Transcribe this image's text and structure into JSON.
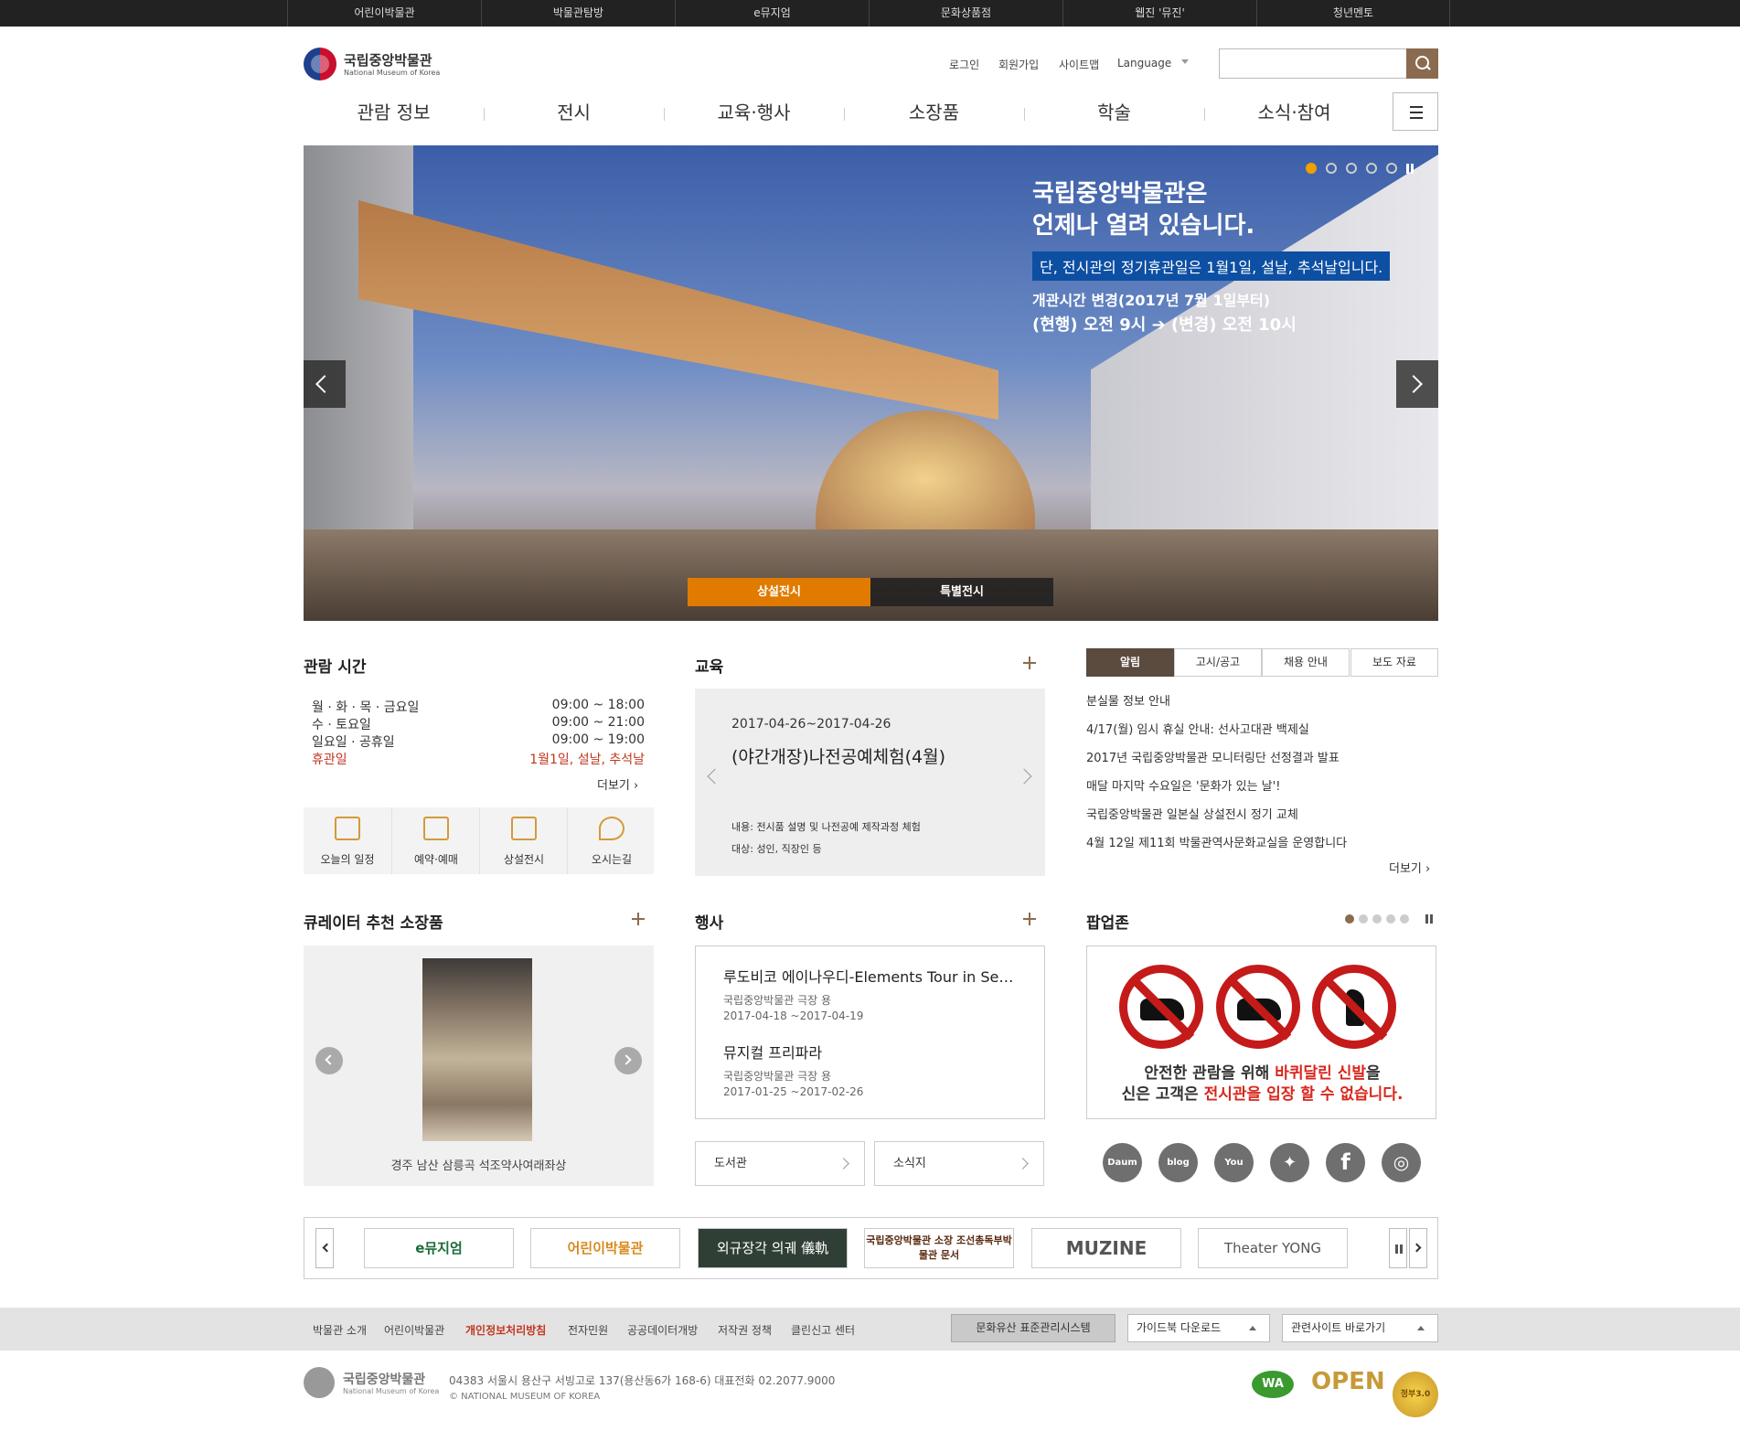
{
  "topbar": [
    "어린이박물관",
    "박물관탐방",
    "e뮤지엄",
    "문화상품점",
    "웹진 '뮤진'",
    "청년멘토"
  ],
  "header": {
    "logo_kr": "국립중앙박물관",
    "logo_en": "National Museum of Korea",
    "util": [
      "로그인",
      "회원가입",
      "사이트맵",
      "Language"
    ]
  },
  "gnb": [
    "관람 정보",
    "전시",
    "교육·행사",
    "소장품",
    "학술",
    "소식·참여"
  ],
  "hero": {
    "line1": "국립중앙박물관은",
    "line2": "언제나 열려 있습니다.",
    "note": "단, 전시관의 정기휴관일은 1월1일, 설날, 추석날입니다.",
    "change": "개관시간 변경(2017년 7월 1일부터)",
    "change2": "(현행) 오전 9시 ➔ (변경) 오전 10시",
    "tabs": [
      "상설전시",
      "특별전시"
    ],
    "active_slide": 1,
    "slide_count": 5
  },
  "hours": {
    "title": "관람 시간",
    "rows": [
      {
        "day": "월 · 화 · 목 · 금요일",
        "time": "09:00 ~ 18:00"
      },
      {
        "day": "수 · 토요일",
        "time": "09:00 ~ 21:00"
      },
      {
        "day": "일요일 · 공휴일",
        "time": "09:00 ~ 19:00"
      },
      {
        "day": "휴관일",
        "time": "1월1일, 설날, 추석날"
      }
    ],
    "more": "더보기"
  },
  "quick": [
    "오늘의 일정",
    "예약·예매",
    "상설전시",
    "오시는길"
  ],
  "education": {
    "title": "교육",
    "date": "2017-04-26~2017-04-26",
    "name": "(야간개장)나전공예체험(4월)",
    "content": "내용: 전시품 설명 및 나전공예 제작과정 체험",
    "target": "대상: 성인, 직장인 등"
  },
  "notice_tabs": [
    "알림",
    "고시/공고",
    "채용 안내",
    "보도 자료"
  ],
  "notices": [
    "분실물 정보 안내",
    "4/17(월) 임시 휴실 안내: 선사고대관 백제실",
    "2017년 국립중앙박물관 모니터링단 선정결과 발표",
    "매달 마지막 수요일은 '문화가 있는 날'!",
    "국립중앙박물관 일본실 상설전시 정기 교체",
    "4월 12일 제11회 박물관역사문화교실을 운영합니다"
  ],
  "notice_more": "더보기",
  "curator": {
    "title": "큐레이터 추천 소장품",
    "caption": "경주 남산 삼릉곡 석조약사여래좌상"
  },
  "event": {
    "title": "행사",
    "items": [
      {
        "name": "루도비코 에이나우디-Elements Tour in Se…",
        "place": "국립중앙박물관 극장 용",
        "date": "2017-04-18 ~2017-04-19"
      },
      {
        "name": "뮤지컬 프리파라",
        "place": "국립중앙박물관 극장 용",
        "date": "2017-01-25 ~2017-02-26"
      }
    ]
  },
  "links": [
    "도서관",
    "소식지"
  ],
  "popup": {
    "title": "팝업존",
    "line1_a": "안전한 관람을 위해 ",
    "line1_b": "바퀴달린 신발",
    "line1_c": "을",
    "line2_a": "신은 고객은 ",
    "line2_b": "전시관을 입장 할 수 없습니다.",
    "active_dot": 1,
    "dot_count": 5
  },
  "sns": [
    "Daum 블로그",
    "NAVER blog",
    "YouTube",
    "Twitter",
    "Facebook",
    "Instagram"
  ],
  "banners": [
    "e뮤지엄",
    "어린이박물관",
    "외규장각 의궤 儀軌",
    "국립중앙박물관 소장 조선총독부박물관 문서",
    "MUZINE",
    "Theater YONG"
  ],
  "footer": {
    "links": [
      "박물관 소개",
      "어린이박물관",
      "개인정보처리방침",
      "전자민원",
      "공공데이터개방",
      "저작권 정책",
      "클린신고 센터"
    ],
    "system_btn": "문화유산 표준관리시스템",
    "guidebook": "가이드북 다운로드",
    "related": "관련사이트 바로가기",
    "address": "04383 서울시 용산구 서빙고로 137(용산동6가 168-6)   대표전화 02.2077.9000",
    "copyright": "© NATIONAL MUSEUM OF KOREA",
    "certs": [
      "WA",
      "OPEN",
      "정부3.0"
    ]
  },
  "colors": {
    "accent": "#8b6b4f",
    "orange": "#e07b00",
    "red": "#c2361f",
    "topbar": "#222222"
  }
}
